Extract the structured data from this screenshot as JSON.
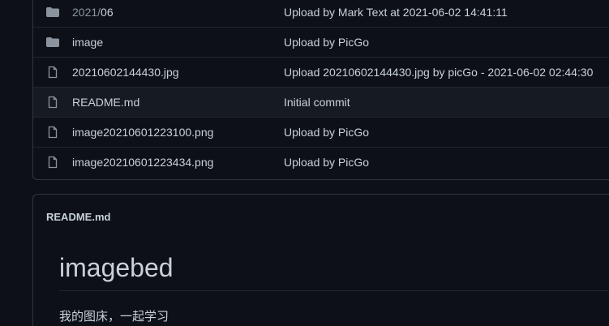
{
  "files": [
    {
      "type": "folder",
      "name_parent": "2021/",
      "name_last": "06",
      "commit": "Upload by Mark Text at 2021-06-02 14:41:11"
    },
    {
      "type": "folder",
      "name": "image",
      "commit": "Upload by PicGo"
    },
    {
      "type": "file",
      "name": "20210602144430.jpg",
      "commit": "Upload 20210602144430.jpg by picGo - 2021-06-02 02:44:30"
    },
    {
      "type": "file",
      "name": "README.md",
      "commit": "Initial commit"
    },
    {
      "type": "file",
      "name": "image20210601223100.png",
      "commit": "Upload by PicGo"
    },
    {
      "type": "file",
      "name": "image20210601223434.png",
      "commit": "Upload by PicGo"
    }
  ],
  "readme": {
    "title": "README.md",
    "heading": "imagebed",
    "paragraph": "我的图床，一起学习"
  },
  "colors": {
    "background": "#0d1117",
    "border": "#30363d",
    "text": "#c9d1d9",
    "muted": "#8b949e",
    "hover_row": "#161b22"
  },
  "icons": {
    "folder": "folder-icon",
    "file": "file-icon"
  }
}
